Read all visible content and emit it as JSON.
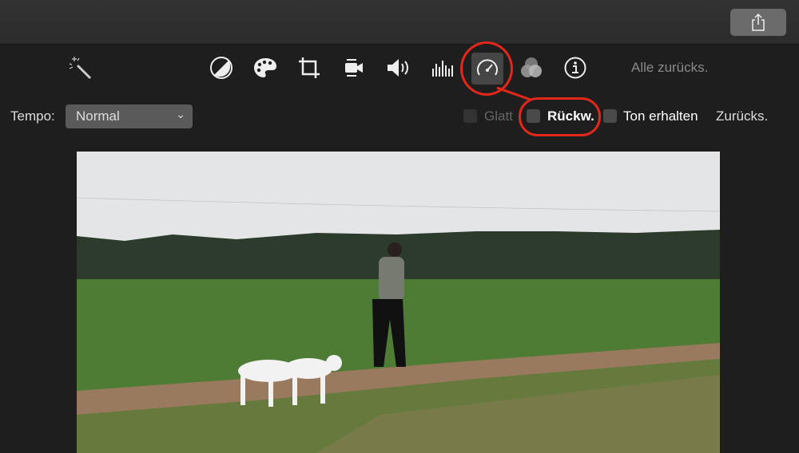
{
  "toolbar": {
    "icons": [
      "magic-wand",
      "color-balance",
      "color-palette",
      "crop",
      "stabilization-camera",
      "volume",
      "equalizer",
      "speedometer",
      "filter-circles",
      "info"
    ],
    "selected": "speedometer",
    "reset_all_label": "Alle zurücks."
  },
  "speed": {
    "tempo_label": "Tempo:",
    "tempo_value": "Normal",
    "smooth_label": "Glatt",
    "smooth_checked": false,
    "reverse_label": "Rückw.",
    "reverse_checked": false,
    "preserve_audio_label": "Ton erhalten",
    "preserve_audio_checked": false,
    "reset_label": "Zurücks."
  },
  "colors": {
    "highlight": "#e4271b",
    "background": "#1e1e1e"
  }
}
